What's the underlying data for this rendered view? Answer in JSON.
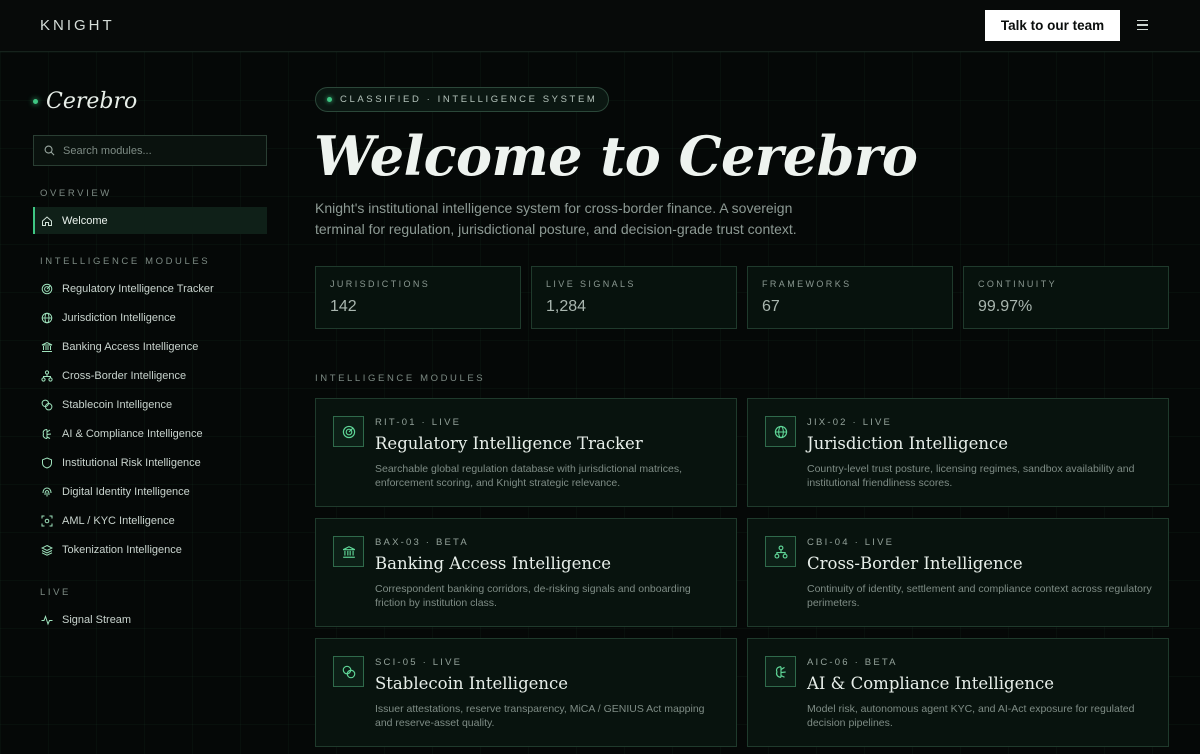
{
  "header": {
    "brand": "KNIGHT",
    "cta_label": "Talk to our team",
    "menu_icon": "menu-icon"
  },
  "sidebar": {
    "logo": "Cerebro",
    "search_placeholder": "Search modules...",
    "overview_label": "OVERVIEW",
    "welcome_label": "Welcome",
    "modules_label": "INTELLIGENCE MODULES",
    "items": [
      {
        "label": "Regulatory Intelligence Tracker",
        "icon": "radar-icon"
      },
      {
        "label": "Jurisdiction Intelligence",
        "icon": "globe-icon"
      },
      {
        "label": "Banking Access Intelligence",
        "icon": "bank-icon"
      },
      {
        "label": "Cross-Border Intelligence",
        "icon": "network-icon"
      },
      {
        "label": "Stablecoin Intelligence",
        "icon": "coins-icon"
      },
      {
        "label": "AI & Compliance Intelligence",
        "icon": "brain-icon"
      },
      {
        "label": "Institutional Risk Intelligence",
        "icon": "shield-icon"
      },
      {
        "label": "Digital Identity Intelligence",
        "icon": "fingerprint-icon"
      },
      {
        "label": "AML / KYC Intelligence",
        "icon": "scan-icon"
      },
      {
        "label": "Tokenization Intelligence",
        "icon": "layers-icon"
      }
    ],
    "live_label": "LIVE",
    "signal_label": "Signal Stream"
  },
  "main": {
    "pill": "CLASSIFIED · INTELLIGENCE SYSTEM",
    "title": "Welcome to Cerebro",
    "subtitle": "Knight's institutional intelligence system for cross-border finance. A sovereign terminal for regulation, jurisdictional posture, and decision-grade trust context.",
    "stats": [
      {
        "label": "JURISDICTIONS",
        "value": "142"
      },
      {
        "label": "LIVE SIGNALS",
        "value": "1,284"
      },
      {
        "label": "FRAMEWORKS",
        "value": "67"
      },
      {
        "label": "CONTINUITY",
        "value": "99.97%"
      }
    ],
    "modules_label": "INTELLIGENCE MODULES",
    "cards": [
      {
        "meta": "RIT-01 · LIVE",
        "title": "Regulatory Intelligence Tracker",
        "desc": "Searchable global regulation database with jurisdictional matrices, enforcement scoring, and Knight strategic relevance.",
        "icon": "radar-icon"
      },
      {
        "meta": "JIX-02 · LIVE",
        "title": "Jurisdiction Intelligence",
        "desc": "Country-level trust posture, licensing regimes, sandbox availability and institutional friendliness scores.",
        "icon": "globe-icon"
      },
      {
        "meta": "BAX-03 · BETA",
        "title": "Banking Access Intelligence",
        "desc": "Correspondent banking corridors, de-risking signals and onboarding friction by institution class.",
        "icon": "bank-icon"
      },
      {
        "meta": "CBI-04 · LIVE",
        "title": "Cross-Border Intelligence",
        "desc": "Continuity of identity, settlement and compliance context across regulatory perimeters.",
        "icon": "network-icon"
      },
      {
        "meta": "SCI-05 · LIVE",
        "title": "Stablecoin Intelligence",
        "desc": "Issuer attestations, reserve transparency, MiCA / GENIUS Act mapping and reserve-asset quality.",
        "icon": "coins-icon"
      },
      {
        "meta": "AIC-06 · BETA",
        "title": "AI & Compliance Intelligence",
        "desc": "Model risk, autonomous agent KYC, and AI-Act exposure for regulated decision pipelines.",
        "icon": "brain-icon"
      }
    ]
  },
  "colors": {
    "accent": "#3fc683",
    "background": "#050807",
    "card_border": "#1f3a2c"
  }
}
